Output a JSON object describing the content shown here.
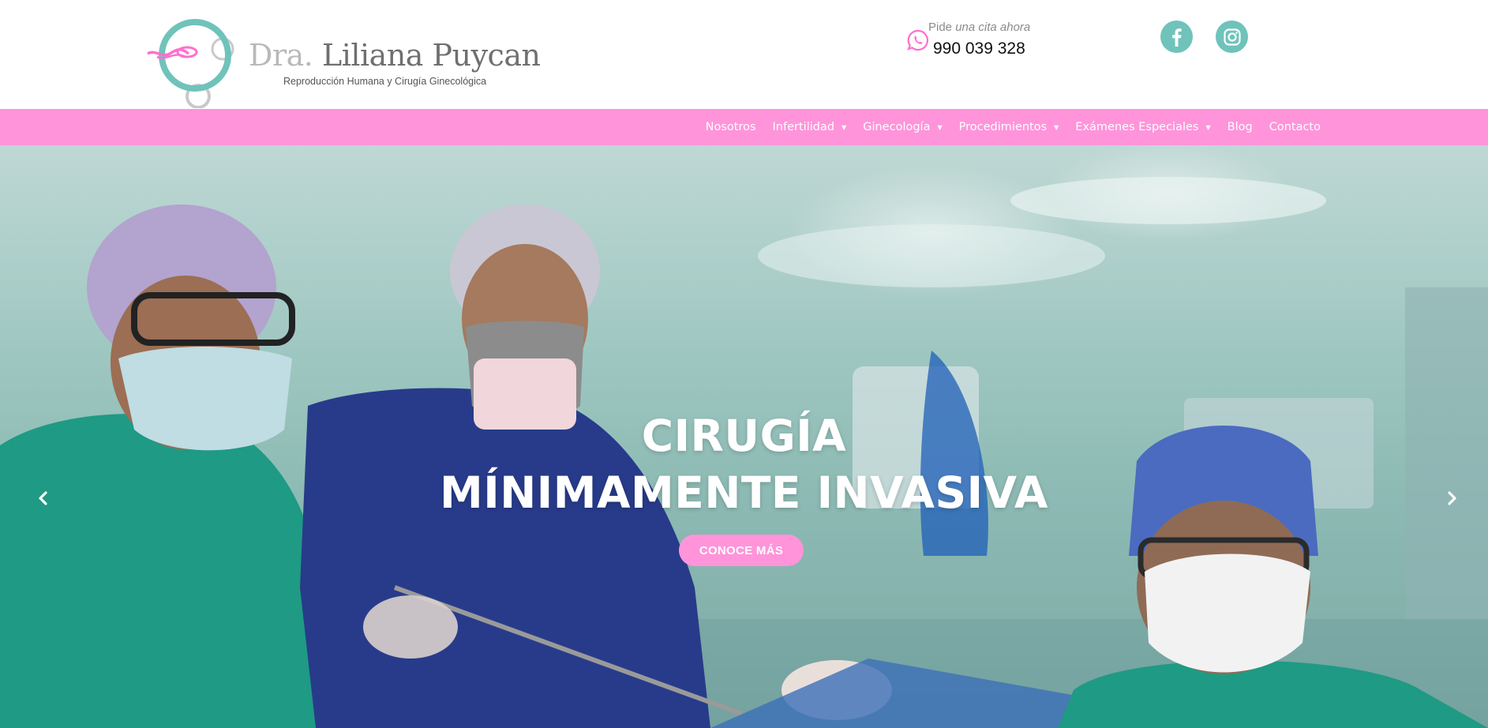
{
  "brand": {
    "prefix": "Dra.",
    "name": "Liliana Puycan",
    "tagline": "Reproducción Humana y Cirugía Ginecológica"
  },
  "contact": {
    "label_plain": "Pide",
    "label_italic": "una cita ahora",
    "phone": "990 039 328",
    "icon": "whatsapp-icon"
  },
  "social": [
    {
      "name": "facebook",
      "icon": "facebook-icon"
    },
    {
      "name": "instagram",
      "icon": "instagram-icon"
    }
  ],
  "nav": {
    "items": [
      {
        "label": "Nosotros",
        "dropdown": false
      },
      {
        "label": "Infertilidad",
        "dropdown": true
      },
      {
        "label": "Ginecología",
        "dropdown": true
      },
      {
        "label": "Procedimientos",
        "dropdown": true
      },
      {
        "label": "Exámenes Especiales",
        "dropdown": true
      },
      {
        "label": "Blog",
        "dropdown": false
      },
      {
        "label": "Contacto",
        "dropdown": false
      }
    ]
  },
  "hero": {
    "title_line1": "CIRUGÍA",
    "title_line2": "MÍNIMAMENTE INVASIVA",
    "button_label": "CONOCE MÁS",
    "prev_icon": "chevron-left-icon",
    "next_icon": "chevron-right-icon"
  },
  "colors": {
    "nav_bg": "#ff94da",
    "accent_teal": "#6fc3bb",
    "accent_pink": "#ff94da",
    "white": "#ffffff"
  }
}
